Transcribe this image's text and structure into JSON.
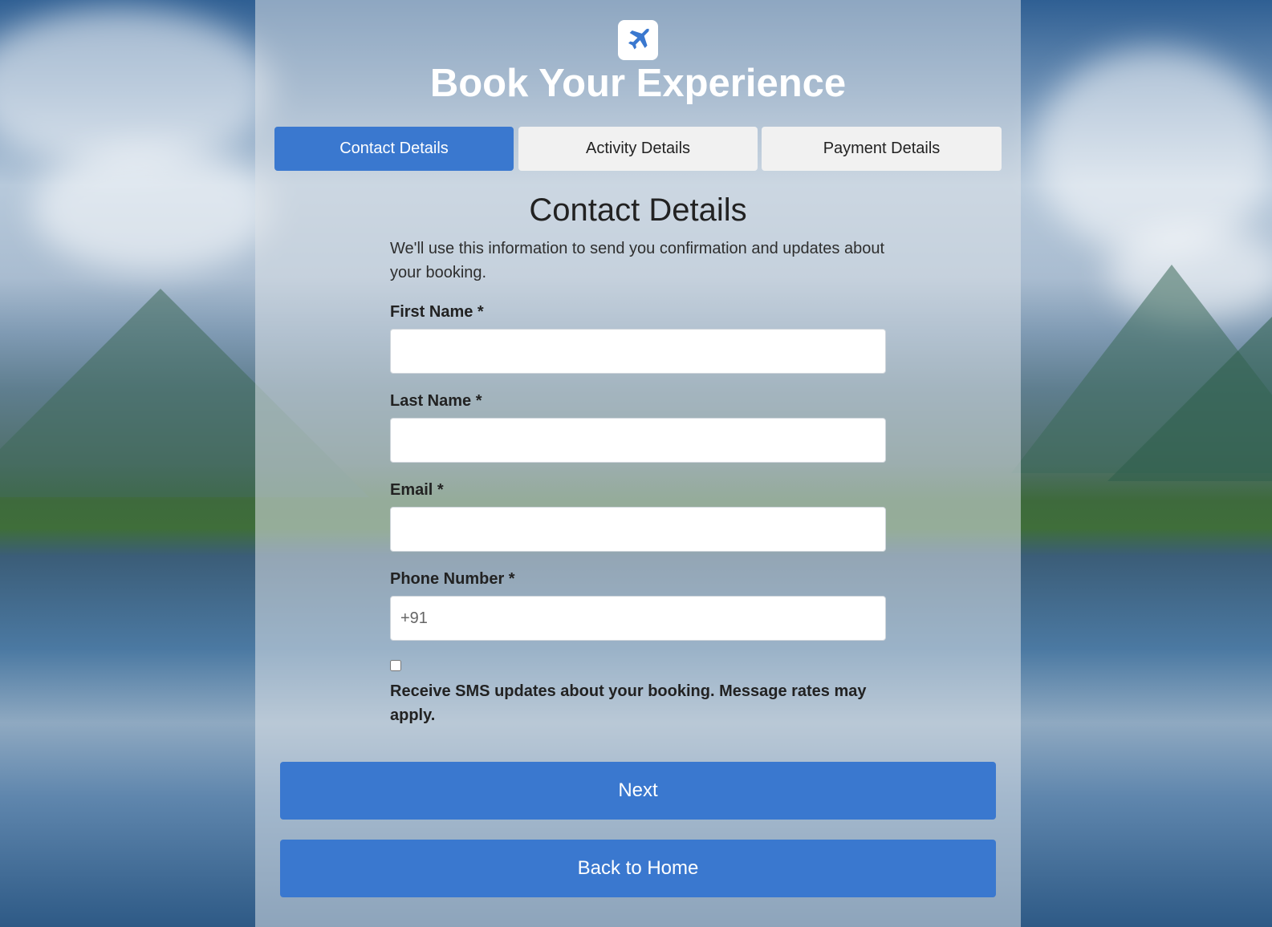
{
  "header": {
    "logo_icon": "airplane-icon",
    "title": "Book Your Experience"
  },
  "tabs": [
    {
      "label": "Contact Details",
      "active": true
    },
    {
      "label": "Activity Details",
      "active": false
    },
    {
      "label": "Payment Details",
      "active": false
    }
  ],
  "form": {
    "section_title": "Contact Details",
    "intro": "We'll use this information to send you confirmation and updates about your booking.",
    "fields": {
      "first_name": {
        "label": "First Name *",
        "value": "",
        "placeholder": ""
      },
      "last_name": {
        "label": "Last Name *",
        "value": "",
        "placeholder": ""
      },
      "email": {
        "label": "Email *",
        "value": "",
        "placeholder": ""
      },
      "phone": {
        "label": "Phone Number *",
        "value": "",
        "placeholder": "+91"
      }
    },
    "sms_optin": {
      "checked": false,
      "label": "Receive SMS updates about your booking. Message rates may apply."
    }
  },
  "buttons": {
    "next": "Next",
    "back_home": "Back to Home"
  },
  "colors": {
    "accent": "#3a78cf",
    "tab_inactive": "#f1f1f1",
    "panel_overlay": "rgba(220,226,232,0.55)"
  }
}
